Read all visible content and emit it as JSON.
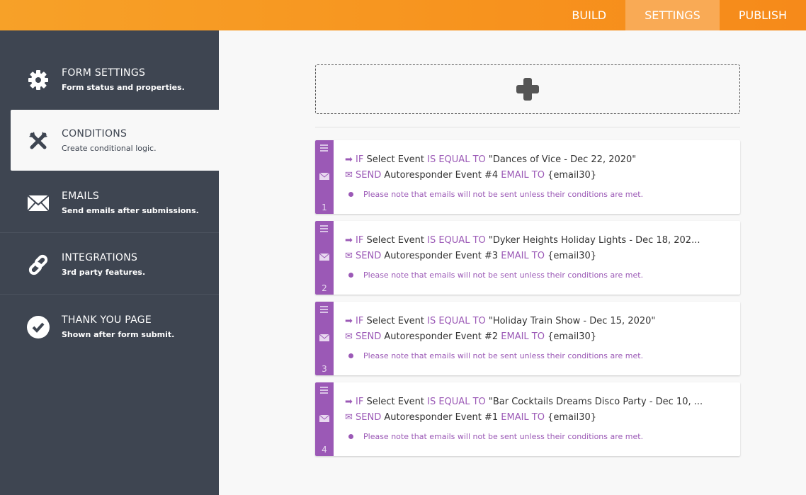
{
  "topbar": {
    "tabs": [
      {
        "label": "BUILD"
      },
      {
        "label": "SETTINGS"
      },
      {
        "label": "PUBLISH"
      }
    ],
    "active": "SETTINGS"
  },
  "sidebar": {
    "items": [
      {
        "title": "FORM SETTINGS",
        "subtitle": "Form status and properties.",
        "icon": "gear-icon"
      },
      {
        "title": "CONDITIONS",
        "subtitle": "Create conditional logic.",
        "icon": "conditions-icon"
      },
      {
        "title": "EMAILS",
        "subtitle": "Send emails after submissions.",
        "icon": "envelope-icon"
      },
      {
        "title": "INTEGRATIONS",
        "subtitle": "3rd party features.",
        "icon": "link-icon"
      },
      {
        "title": "THANK YOU PAGE",
        "subtitle": "Shown after form submit.",
        "icon": "check-circle-icon"
      }
    ]
  },
  "keywords": {
    "if": "IF",
    "is_equal_to": "IS EQUAL TO",
    "send": "SEND",
    "email_to": "EMAIL TO"
  },
  "conditions": [
    {
      "number": "1",
      "field": "Select Event",
      "value": "\"Dances of Vice - Dec 22, 2020\"",
      "action_target": "Autoresponder Event #4",
      "email": "{email30}",
      "note": "Please note that emails will not be sent unless their conditions are met."
    },
    {
      "number": "2",
      "field": "Select Event",
      "value": "\"Dyker Heights Holiday Lights - Dec 18, 202...",
      "action_target": "Autoresponder Event #3",
      "email": "{email30}",
      "note": "Please note that emails will not be sent unless their conditions are met."
    },
    {
      "number": "3",
      "field": "Select Event",
      "value": "\"Holiday Train Show - Dec 15, 2020\"",
      "action_target": "Autoresponder Event #2",
      "email": "{email30}",
      "note": "Please note that emails will not be sent unless their conditions are met."
    },
    {
      "number": "4",
      "field": "Select Event",
      "value": "\"Bar Cocktails Dreams Disco Party - Dec 10, ...",
      "action_target": "Autoresponder Event #1",
      "email": "{email30}",
      "note": "Please note that emails will not be sent unless their conditions are met."
    }
  ]
}
